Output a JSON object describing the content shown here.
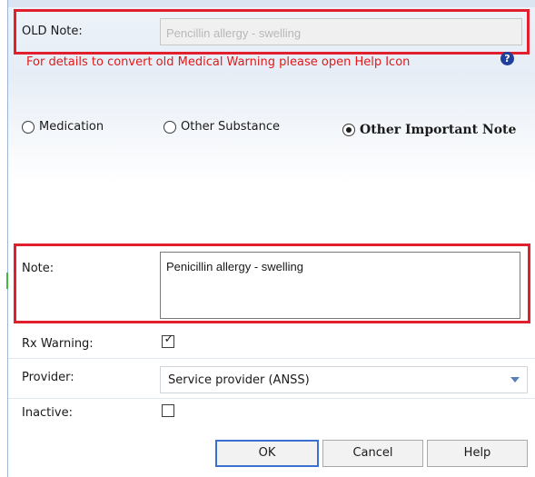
{
  "old_note": {
    "label": "OLD Note:",
    "value": "Pencillin allergy - swelling",
    "info_text": "For details to convert old Medical Warning please open Help Icon",
    "help_icon": "help-circle-icon",
    "help_glyph": "?"
  },
  "type_options": [
    {
      "label": "Medication",
      "selected": false
    },
    {
      "label": "Other Substance",
      "selected": false
    },
    {
      "label": "Other Important Note",
      "selected": true
    }
  ],
  "note": {
    "label": "Note:",
    "value": "Penicillin allergy - swelling"
  },
  "rx_warning": {
    "label": "Rx Warning:",
    "checked": true,
    "mark": "✓"
  },
  "provider": {
    "label": "Provider:",
    "value": "Service provider (ANSS)"
  },
  "inactive": {
    "label": "Inactive:",
    "checked": false
  },
  "buttons": {
    "ok": "OK",
    "cancel": "Cancel",
    "help": "Help"
  },
  "colors": {
    "highlight": "#e0202e",
    "info_text": "#e11a1a",
    "primary_button_border": "#3b6fd0"
  }
}
